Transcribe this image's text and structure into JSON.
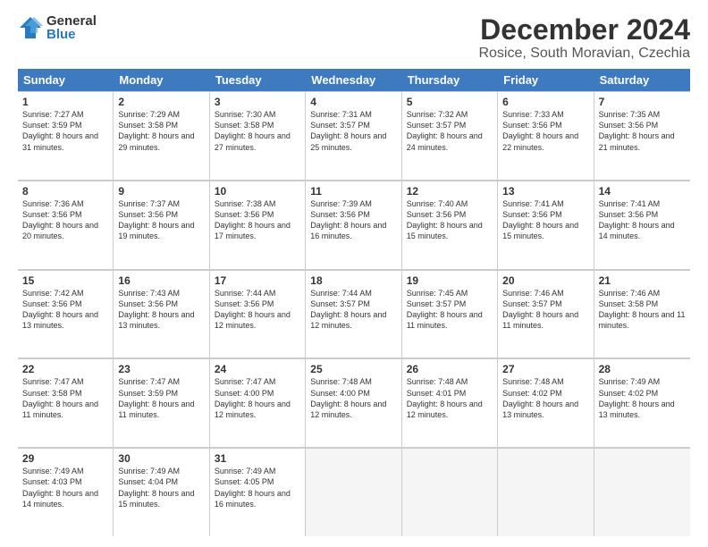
{
  "logo": {
    "general": "General",
    "blue": "Blue"
  },
  "header": {
    "month": "December 2024",
    "location": "Rosice, South Moravian, Czechia"
  },
  "days": [
    "Sunday",
    "Monday",
    "Tuesday",
    "Wednesday",
    "Thursday",
    "Friday",
    "Saturday"
  ],
  "weeks": [
    [
      {
        "day": "1",
        "sunrise": "Sunrise: 7:27 AM",
        "sunset": "Sunset: 3:59 PM",
        "daylight": "Daylight: 8 hours and 31 minutes."
      },
      {
        "day": "2",
        "sunrise": "Sunrise: 7:29 AM",
        "sunset": "Sunset: 3:58 PM",
        "daylight": "Daylight: 8 hours and 29 minutes."
      },
      {
        "day": "3",
        "sunrise": "Sunrise: 7:30 AM",
        "sunset": "Sunset: 3:58 PM",
        "daylight": "Daylight: 8 hours and 27 minutes."
      },
      {
        "day": "4",
        "sunrise": "Sunrise: 7:31 AM",
        "sunset": "Sunset: 3:57 PM",
        "daylight": "Daylight: 8 hours and 25 minutes."
      },
      {
        "day": "5",
        "sunrise": "Sunrise: 7:32 AM",
        "sunset": "Sunset: 3:57 PM",
        "daylight": "Daylight: 8 hours and 24 minutes."
      },
      {
        "day": "6",
        "sunrise": "Sunrise: 7:33 AM",
        "sunset": "Sunset: 3:56 PM",
        "daylight": "Daylight: 8 hours and 22 minutes."
      },
      {
        "day": "7",
        "sunrise": "Sunrise: 7:35 AM",
        "sunset": "Sunset: 3:56 PM",
        "daylight": "Daylight: 8 hours and 21 minutes."
      }
    ],
    [
      {
        "day": "8",
        "sunrise": "Sunrise: 7:36 AM",
        "sunset": "Sunset: 3:56 PM",
        "daylight": "Daylight: 8 hours and 20 minutes."
      },
      {
        "day": "9",
        "sunrise": "Sunrise: 7:37 AM",
        "sunset": "Sunset: 3:56 PM",
        "daylight": "Daylight: 8 hours and 19 minutes."
      },
      {
        "day": "10",
        "sunrise": "Sunrise: 7:38 AM",
        "sunset": "Sunset: 3:56 PM",
        "daylight": "Daylight: 8 hours and 17 minutes."
      },
      {
        "day": "11",
        "sunrise": "Sunrise: 7:39 AM",
        "sunset": "Sunset: 3:56 PM",
        "daylight": "Daylight: 8 hours and 16 minutes."
      },
      {
        "day": "12",
        "sunrise": "Sunrise: 7:40 AM",
        "sunset": "Sunset: 3:56 PM",
        "daylight": "Daylight: 8 hours and 15 minutes."
      },
      {
        "day": "13",
        "sunrise": "Sunrise: 7:41 AM",
        "sunset": "Sunset: 3:56 PM",
        "daylight": "Daylight: 8 hours and 15 minutes."
      },
      {
        "day": "14",
        "sunrise": "Sunrise: 7:41 AM",
        "sunset": "Sunset: 3:56 PM",
        "daylight": "Daylight: 8 hours and 14 minutes."
      }
    ],
    [
      {
        "day": "15",
        "sunrise": "Sunrise: 7:42 AM",
        "sunset": "Sunset: 3:56 PM",
        "daylight": "Daylight: 8 hours and 13 minutes."
      },
      {
        "day": "16",
        "sunrise": "Sunrise: 7:43 AM",
        "sunset": "Sunset: 3:56 PM",
        "daylight": "Daylight: 8 hours and 13 minutes."
      },
      {
        "day": "17",
        "sunrise": "Sunrise: 7:44 AM",
        "sunset": "Sunset: 3:56 PM",
        "daylight": "Daylight: 8 hours and 12 minutes."
      },
      {
        "day": "18",
        "sunrise": "Sunrise: 7:44 AM",
        "sunset": "Sunset: 3:57 PM",
        "daylight": "Daylight: 8 hours and 12 minutes."
      },
      {
        "day": "19",
        "sunrise": "Sunrise: 7:45 AM",
        "sunset": "Sunset: 3:57 PM",
        "daylight": "Daylight: 8 hours and 11 minutes."
      },
      {
        "day": "20",
        "sunrise": "Sunrise: 7:46 AM",
        "sunset": "Sunset: 3:57 PM",
        "daylight": "Daylight: 8 hours and 11 minutes."
      },
      {
        "day": "21",
        "sunrise": "Sunrise: 7:46 AM",
        "sunset": "Sunset: 3:58 PM",
        "daylight": "Daylight: 8 hours and 11 minutes."
      }
    ],
    [
      {
        "day": "22",
        "sunrise": "Sunrise: 7:47 AM",
        "sunset": "Sunset: 3:58 PM",
        "daylight": "Daylight: 8 hours and 11 minutes."
      },
      {
        "day": "23",
        "sunrise": "Sunrise: 7:47 AM",
        "sunset": "Sunset: 3:59 PM",
        "daylight": "Daylight: 8 hours and 11 minutes."
      },
      {
        "day": "24",
        "sunrise": "Sunrise: 7:47 AM",
        "sunset": "Sunset: 4:00 PM",
        "daylight": "Daylight: 8 hours and 12 minutes."
      },
      {
        "day": "25",
        "sunrise": "Sunrise: 7:48 AM",
        "sunset": "Sunset: 4:00 PM",
        "daylight": "Daylight: 8 hours and 12 minutes."
      },
      {
        "day": "26",
        "sunrise": "Sunrise: 7:48 AM",
        "sunset": "Sunset: 4:01 PM",
        "daylight": "Daylight: 8 hours and 12 minutes."
      },
      {
        "day": "27",
        "sunrise": "Sunrise: 7:48 AM",
        "sunset": "Sunset: 4:02 PM",
        "daylight": "Daylight: 8 hours and 13 minutes."
      },
      {
        "day": "28",
        "sunrise": "Sunrise: 7:49 AM",
        "sunset": "Sunset: 4:02 PM",
        "daylight": "Daylight: 8 hours and 13 minutes."
      }
    ],
    [
      {
        "day": "29",
        "sunrise": "Sunrise: 7:49 AM",
        "sunset": "Sunset: 4:03 PM",
        "daylight": "Daylight: 8 hours and 14 minutes."
      },
      {
        "day": "30",
        "sunrise": "Sunrise: 7:49 AM",
        "sunset": "Sunset: 4:04 PM",
        "daylight": "Daylight: 8 hours and 15 minutes."
      },
      {
        "day": "31",
        "sunrise": "Sunrise: 7:49 AM",
        "sunset": "Sunset: 4:05 PM",
        "daylight": "Daylight: 8 hours and 16 minutes."
      },
      null,
      null,
      null,
      null
    ]
  ]
}
